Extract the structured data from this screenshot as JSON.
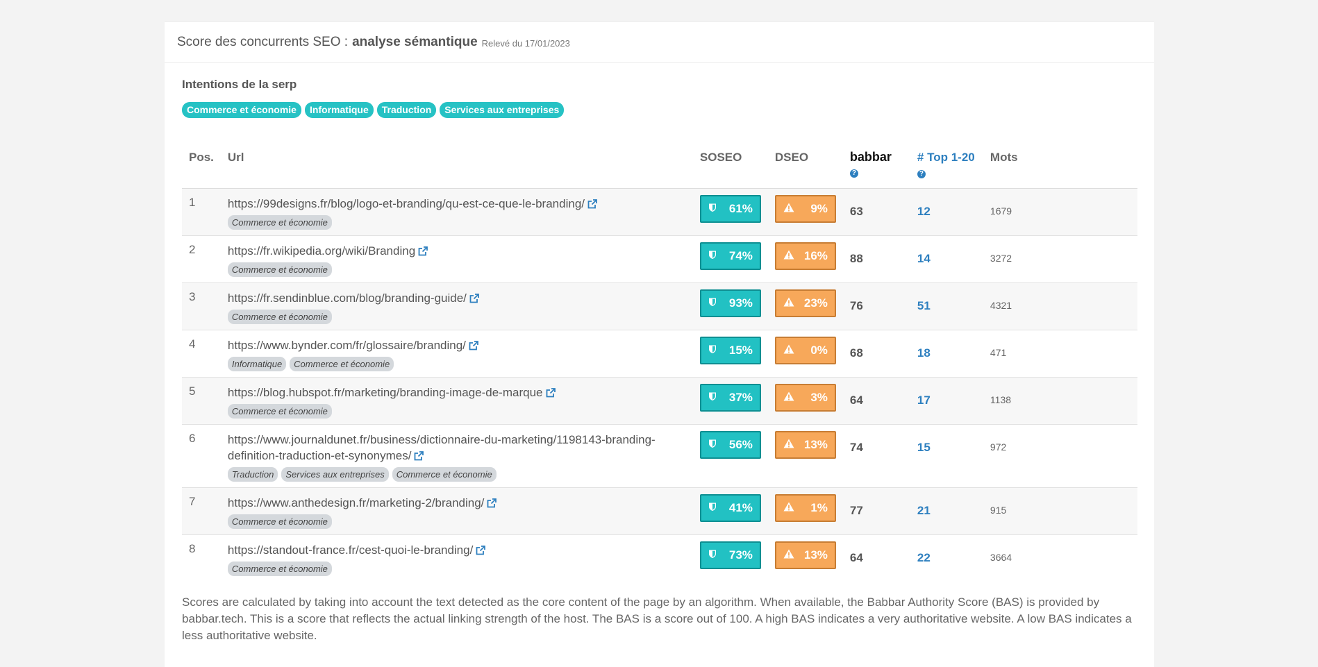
{
  "header": {
    "title": "Score des concurrents SEO :",
    "subtitle": "analyse sémantique",
    "date": "Relevé du 17/01/2023"
  },
  "intents": {
    "title": "Intentions de la serp",
    "chips": [
      "Commerce et économie",
      "Informatique",
      "Traduction",
      "Services aux entreprises"
    ]
  },
  "table": {
    "headers": {
      "pos": "Pos.",
      "url": "Url",
      "soseo": "SOSEO",
      "dseo": "DSEO",
      "babbar": "babbar",
      "top": "# Top 1-20",
      "words": "Mots"
    },
    "rows": [
      {
        "pos": "1",
        "url": "https://99designs.fr/blog/logo-et-branding/qu-est-ce-que-le-branding/",
        "tags": [
          "Commerce et économie"
        ],
        "soseo": "61%",
        "dseo": "9%",
        "babbar": "63",
        "top": "12",
        "words": "1679"
      },
      {
        "pos": "2",
        "url": "https://fr.wikipedia.org/wiki/Branding",
        "tags": [
          "Commerce et économie"
        ],
        "soseo": "74%",
        "dseo": "16%",
        "babbar": "88",
        "top": "14",
        "words": "3272"
      },
      {
        "pos": "3",
        "url": "https://fr.sendinblue.com/blog/branding-guide/",
        "tags": [
          "Commerce et économie"
        ],
        "soseo": "93%",
        "dseo": "23%",
        "babbar": "76",
        "top": "51",
        "words": "4321"
      },
      {
        "pos": "4",
        "url": "https://www.bynder.com/fr/glossaire/branding/",
        "tags": [
          "Informatique",
          "Commerce et économie"
        ],
        "soseo": "15%",
        "dseo": "0%",
        "babbar": "68",
        "top": "18",
        "words": "471"
      },
      {
        "pos": "5",
        "url": "https://blog.hubspot.fr/marketing/branding-image-de-marque",
        "tags": [
          "Commerce et économie"
        ],
        "soseo": "37%",
        "dseo": "3%",
        "babbar": "64",
        "top": "17",
        "words": "1138"
      },
      {
        "pos": "6",
        "url": "https://www.journaldunet.fr/business/dictionnaire-du-marketing/1198143-branding-definition-traduction-et-synonymes/",
        "tags": [
          "Traduction",
          "Services aux entreprises",
          "Commerce et économie"
        ],
        "soseo": "56%",
        "dseo": "13%",
        "babbar": "74",
        "top": "15",
        "words": "972"
      },
      {
        "pos": "7",
        "url": "https://www.anthedesign.fr/marketing-2/branding/",
        "tags": [
          "Commerce et économie"
        ],
        "soseo": "41%",
        "dseo": "1%",
        "babbar": "77",
        "top": "21",
        "words": "915"
      },
      {
        "pos": "8",
        "url": "https://standout-france.fr/cest-quoi-le-branding/",
        "tags": [
          "Commerce et économie"
        ],
        "soseo": "73%",
        "dseo": "13%",
        "babbar": "64",
        "top": "22",
        "words": "3664"
      }
    ]
  },
  "footer": {
    "text": "Scores are calculated by taking into account the text detected as the core content of the page by an algorithm. When available, the Babbar Authority Score (BAS) is provided by babbar.tech. This is a score that reflects the actual linking strength of the host. The BAS is a score out of 100. A high BAS indicates a very authoritative website. A low BAS indicates a less authoritative website."
  },
  "colors": {
    "soseo": "#22c1c3",
    "dseo": "#f7a85a",
    "link": "#2d7fbf",
    "chip": "#26c2c4"
  },
  "icons": {
    "soseo": "shield-icon",
    "dseo": "warning-icon",
    "external": "external-link-icon",
    "help": "question-circle-icon"
  }
}
